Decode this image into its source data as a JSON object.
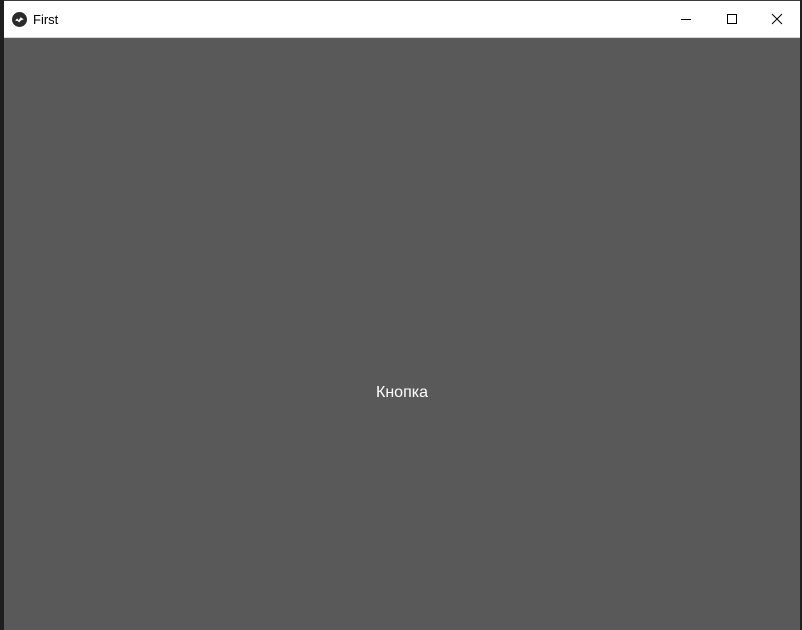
{
  "window": {
    "title": "First",
    "app_icon": "kivy-logo-icon",
    "controls": {
      "minimize_icon": "minimize-icon",
      "maximize_icon": "maximize-icon",
      "close_icon": "close-icon"
    }
  },
  "content": {
    "button_label": "Кнопка",
    "background_color": "#595959",
    "text_color": "#ffffff"
  }
}
